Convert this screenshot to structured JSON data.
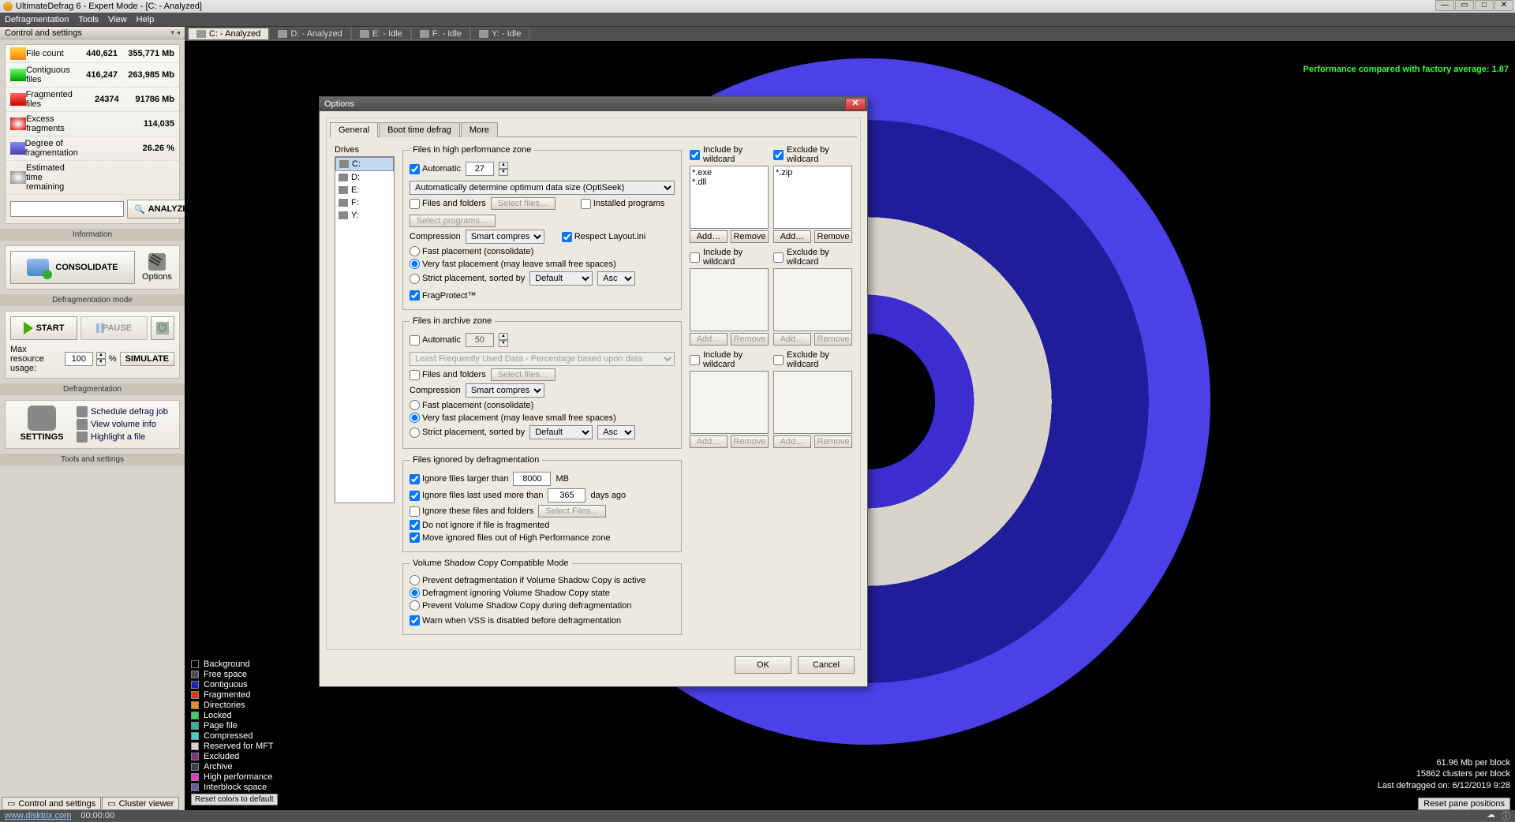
{
  "titlebar": {
    "title": "UltimateDefrag 6 - Expert Mode - [C: - Analyzed]"
  },
  "menubar": [
    "Defragmentation",
    "Tools",
    "View",
    "Help"
  ],
  "sidebar": {
    "header": "Control and settings",
    "stats": [
      {
        "label": "File count",
        "v1": "440,621",
        "v2": "355,771 Mb"
      },
      {
        "label": "Contiguous files",
        "v1": "416,247",
        "v2": "263,985 Mb"
      },
      {
        "label": "Fragmented files",
        "v1": "24374",
        "v2": "91786 Mb"
      },
      {
        "label": "Excess fragments",
        "v1": "",
        "v2": "114,035"
      },
      {
        "label": "Degree of fragmentation",
        "v1": "",
        "v2": "26.26 %"
      },
      {
        "label": "Estimated time remaining",
        "v1": "",
        "v2": ""
      }
    ],
    "analyze": "ANALYZE",
    "information_label": "Information",
    "consolidate": "CONSOLIDATE",
    "options": "Options",
    "defrag_mode_label": "Defragmentation mode",
    "start": "START",
    "pause": "PAUSE",
    "resource_label": "Max resource usage:",
    "resource_val": "100",
    "resource_pct": "%",
    "simulate": "SIMULATE",
    "defrag_label": "Defragmentation",
    "settings": "SETTINGS",
    "tools": [
      {
        "label": "Schedule defrag job"
      },
      {
        "label": "View volume info"
      },
      {
        "label": "Highlight a file"
      }
    ],
    "tools_label": "Tools and settings"
  },
  "drive_tabs": [
    {
      "label": "C: - Analyzed",
      "active": true
    },
    {
      "label": "D: - Analyzed"
    },
    {
      "label": "E: - Idle"
    },
    {
      "label": "F: - Idle"
    },
    {
      "label": "Y: - Idle"
    }
  ],
  "perf_text": "Performance compared with factory average: 1.87",
  "cluster_info": {
    "l1": "61.96 Mb per block",
    "l2": "15862 clusters per block",
    "l3": "Last defragged on: 6/12/2019 9:28"
  },
  "legend": [
    {
      "c": "#000",
      "l": "Background"
    },
    {
      "c": "#505050",
      "l": "Free space"
    },
    {
      "c": "#2020c0",
      "l": "Contiguous"
    },
    {
      "c": "#e03020",
      "l": "Fragmented"
    },
    {
      "c": "#e09020",
      "l": "Directories"
    },
    {
      "c": "#40d060",
      "l": "Locked"
    },
    {
      "c": "#30b0a0",
      "l": "Page file"
    },
    {
      "c": "#40d0d0",
      "l": "Compressed"
    },
    {
      "c": "#d8d4ca",
      "l": "Reserved for MFT"
    },
    {
      "c": "#803080",
      "l": "Excluded"
    },
    {
      "c": "#404040",
      "l": "Archive"
    },
    {
      "c": "#e040c0",
      "l": "High performance"
    },
    {
      "c": "#6060a0",
      "l": "Interblock space"
    }
  ],
  "reset_colors": "Reset colors to default",
  "dialog": {
    "title": "Options",
    "tabs": [
      "General",
      "Boot time defrag",
      "More"
    ],
    "drives_label": "Drives",
    "drives": [
      "C:",
      "D:",
      "E:",
      "F:",
      "Y:"
    ],
    "hp": {
      "legend": "Files in high performance zone",
      "auto": "Automatic",
      "auto_val": "27",
      "auto_mode": "Automatically determine optimum data size (OptiSeek)",
      "files_folders": "Files and folders",
      "select_files": "Select files…",
      "installed_programs": "Installed programs",
      "select_programs": "Select programs…",
      "compression": "Compression",
      "compression_val": "Smart compress",
      "respect": "Respect Layout.ini",
      "r1": "Fast placement (consolidate)",
      "r2": "Very fast placement (may leave small free spaces)",
      "r3": "Strict placement, sorted by",
      "sort_by": "Default",
      "sort_dir": "Asc",
      "fragprotect": "FragProtect™"
    },
    "archive": {
      "legend": "Files in archive zone",
      "auto": "Automatic",
      "auto_val": "50",
      "auto_mode": "Least Frequently Used Data - Percentage based upon data",
      "files_folders": "Files and folders",
      "select_files": "Select files…",
      "compression": "Compression",
      "compression_val": "Smart compress",
      "r1": "Fast placement (consolidate)",
      "r2": "Very fast placement (may leave small free spaces)",
      "r3": "Strict placement, sorted by",
      "sort_by": "Default",
      "sort_dir": "Asc"
    },
    "ignored": {
      "legend": "Files ignored by defragmentation",
      "ignore_larger": "Ignore files larger than",
      "larger_val": "8000",
      "mb": "MB",
      "ignore_older": "Ignore files last used more than",
      "older_val": "365",
      "days": "days ago",
      "ignore_these": "Ignore these files and folders",
      "select_files": "Select Files…",
      "do_not": "Do not ignore if file is fragmented",
      "move_out": "Move ignored files out of High Performance zone"
    },
    "vss": {
      "legend": "Volume Shadow Copy Compatible Mode",
      "r1": "Prevent defragmentation if Volume Shadow Copy is active",
      "r2": "Defragment ignoring Volume Shadow Copy state",
      "r3": "Prevent Volume Shadow Copy during defragmentation",
      "warn": "Warn when VSS is disabled before defragmentation"
    },
    "wc": {
      "include": "Include by wildcard",
      "exclude": "Exclude by wildcard",
      "include_items": [
        "*.exe",
        "*.dll"
      ],
      "exclude_items": [
        "*.zip"
      ],
      "add": "Add…",
      "remove": "Remove"
    },
    "ok": "OK",
    "cancel": "Cancel"
  },
  "bottom_tabs": [
    "Control and settings",
    "Cluster viewer"
  ],
  "reset_positions": "Reset pane positions",
  "status": {
    "url": "www.disktrix.com",
    "time": "00:00:00"
  }
}
